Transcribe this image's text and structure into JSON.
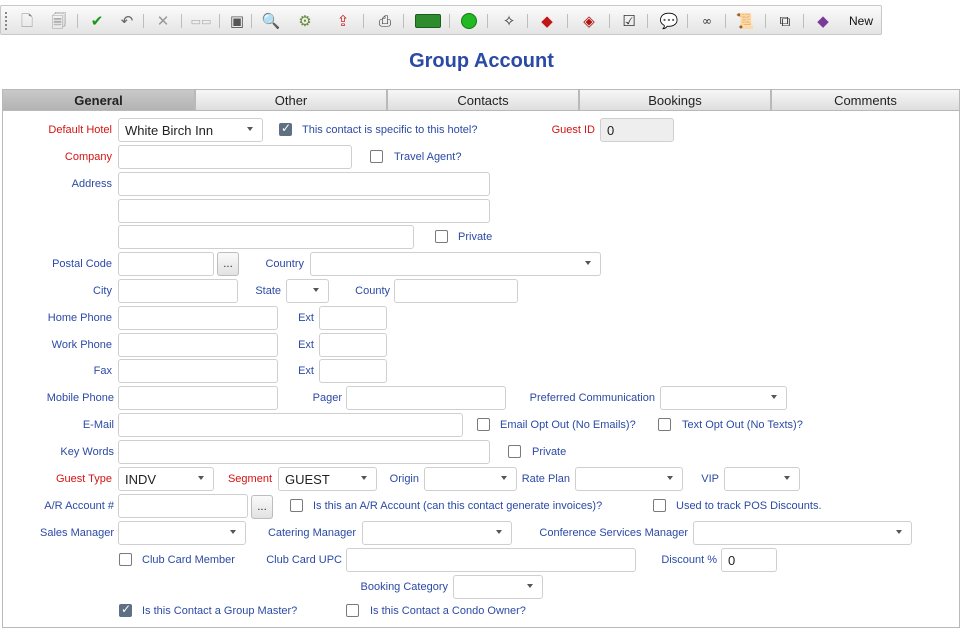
{
  "toolbar": {
    "new_label": "New",
    "icons": [
      "grip-icon",
      "new-doc-icon",
      "copy-doc-icon",
      "save-check-icon",
      "undo-icon",
      "delete-x-icon",
      "cards-icon",
      "calculator-icon",
      "search-plus-icon",
      "money-gear-icon",
      "export-icon",
      "print-report-icon",
      "cash-icon",
      "smiley-icon",
      "wand-icon",
      "book-icon",
      "book-stack-icon",
      "clipboard-check-icon",
      "chat-bubble-icon",
      "binoculars-icon",
      "scroll-icon",
      "pages-icon",
      "tag-icon"
    ]
  },
  "page": {
    "title": "Group Account"
  },
  "tabs": [
    "General",
    "Other",
    "Contacts",
    "Bookings",
    "Comments"
  ],
  "form": {
    "default_hotel_label": "Default Hotel",
    "default_hotel_value": "White Birch Inn",
    "specific_hotel_label": "This contact is specific to this hotel?",
    "guest_id_label": "Guest ID",
    "guest_id_value": "0",
    "company_label": "Company",
    "travel_agent_label": "Travel Agent?",
    "address_label": "Address",
    "private_label": "Private",
    "postal_code_label": "Postal Code",
    "ellipsis": "...",
    "country_label": "Country",
    "city_label": "City",
    "state_label": "State",
    "county_label": "County",
    "home_phone_label": "Home Phone",
    "ext_label": "Ext",
    "work_phone_label": "Work Phone",
    "fax_label": "Fax",
    "mobile_phone_label": "Mobile Phone",
    "pager_label": "Pager",
    "preferred_comm_label": "Preferred Communication",
    "email_label": "E-Mail",
    "email_opt_out_label": "Email Opt Out (No Emails)?",
    "text_opt_out_label": "Text Opt Out (No Texts)?",
    "key_words_label": "Key Words",
    "guest_type_label": "Guest Type",
    "guest_type_value": "INDV",
    "segment_label": "Segment",
    "segment_value": "GUEST",
    "origin_label": "Origin",
    "rate_plan_label": "Rate Plan",
    "vip_label": "VIP",
    "ar_account_label": "A/R Account #",
    "ar_invoice_label": "Is this an A/R Account (can this contact generate invoices)?",
    "pos_discount_label": "Used to track POS Discounts.",
    "sales_manager_label": "Sales Manager",
    "catering_manager_label": "Catering Manager",
    "conf_services_label": "Conference Services Manager",
    "club_card_member_label": "Club Card Member",
    "club_card_upc_label": "Club Card UPC",
    "discount_label": "Discount %",
    "discount_value": "0",
    "booking_category_label": "Booking Category",
    "group_master_label": "Is this Contact a Group Master?",
    "condo_owner_label": "Is this Contact a Condo Owner?"
  },
  "checkboxes": {
    "specific_hotel": true,
    "group_master": true
  },
  "colors": {
    "label_blue": "#2b4aa5",
    "label_red": "#d21414",
    "title_blue": "#2b4aa5"
  }
}
